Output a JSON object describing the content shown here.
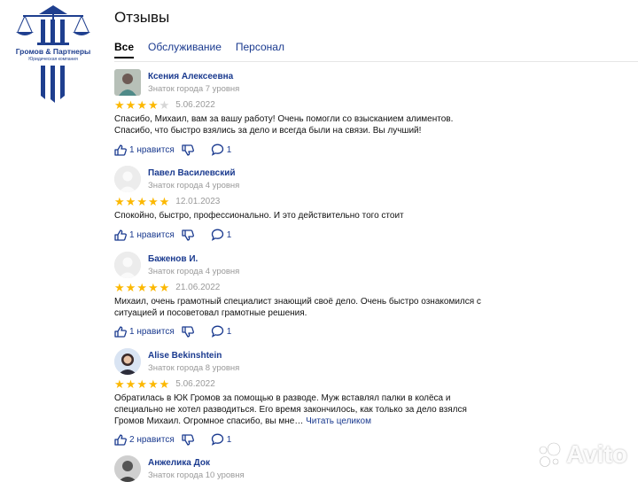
{
  "logo": {
    "name": "Громов & Партнеры",
    "subtitle": "Юридическая компания"
  },
  "page": {
    "title": "Отзывы"
  },
  "tabs": [
    {
      "label": "Все",
      "active": true
    },
    {
      "label": "Обслуживание",
      "active": false
    },
    {
      "label": "Персонал",
      "active": false
    }
  ],
  "reviews": [
    {
      "author": "Ксения Алексеевна",
      "level": "Знаток города 7 уровня",
      "rating": 4,
      "date": "5.06.2022",
      "text": "Спасибо, Михаил, вам за вашу работу! Очень помогли со взысканием алиментов. Спасибо, что быстро взялись за дело и всегда были на связи. Вы лучший!",
      "likes": "1 нравится",
      "comments": "1"
    },
    {
      "author": "Павел Василевский",
      "level": "Знаток города 4 уровня",
      "rating": 5,
      "date": "12.01.2023",
      "text": "Спокойно, быстро, профессионально. И это действительно того стоит",
      "likes": "1 нравится",
      "comments": "1"
    },
    {
      "author": "Баженов И.",
      "level": "Знаток города 4 уровня",
      "rating": 5,
      "date": "21.06.2022",
      "text": "Михаил, очень грамотный специалист знающий своё дело. Очень быстро ознакомился с ситуацией и посоветовал грамотные решения.",
      "likes": "1 нравится",
      "comments": "1"
    },
    {
      "author": "Alise Bekinshtein",
      "level": "Знаток города 8 уровня",
      "rating": 5,
      "date": "5.06.2022",
      "text": "Обратилась в ЮК Громов за помощью в разводе. Муж вставлял палки в колёса и специально не хотел разводиться. Его время закончилось, как только за дело взялся Громов Михаил. Огромное спасибо, вы мне…",
      "more": "Читать целиком",
      "likes": "2 нравится",
      "comments": "1"
    },
    {
      "author": "Анжелика Док",
      "level": "Знаток города 10 уровня"
    }
  ],
  "watermark": {
    "text": "Avito"
  },
  "colors": {
    "link": "#1a3a8f",
    "star": "#fcb800",
    "muted": "#9a9a9a",
    "logo": "#1f3f8f"
  }
}
